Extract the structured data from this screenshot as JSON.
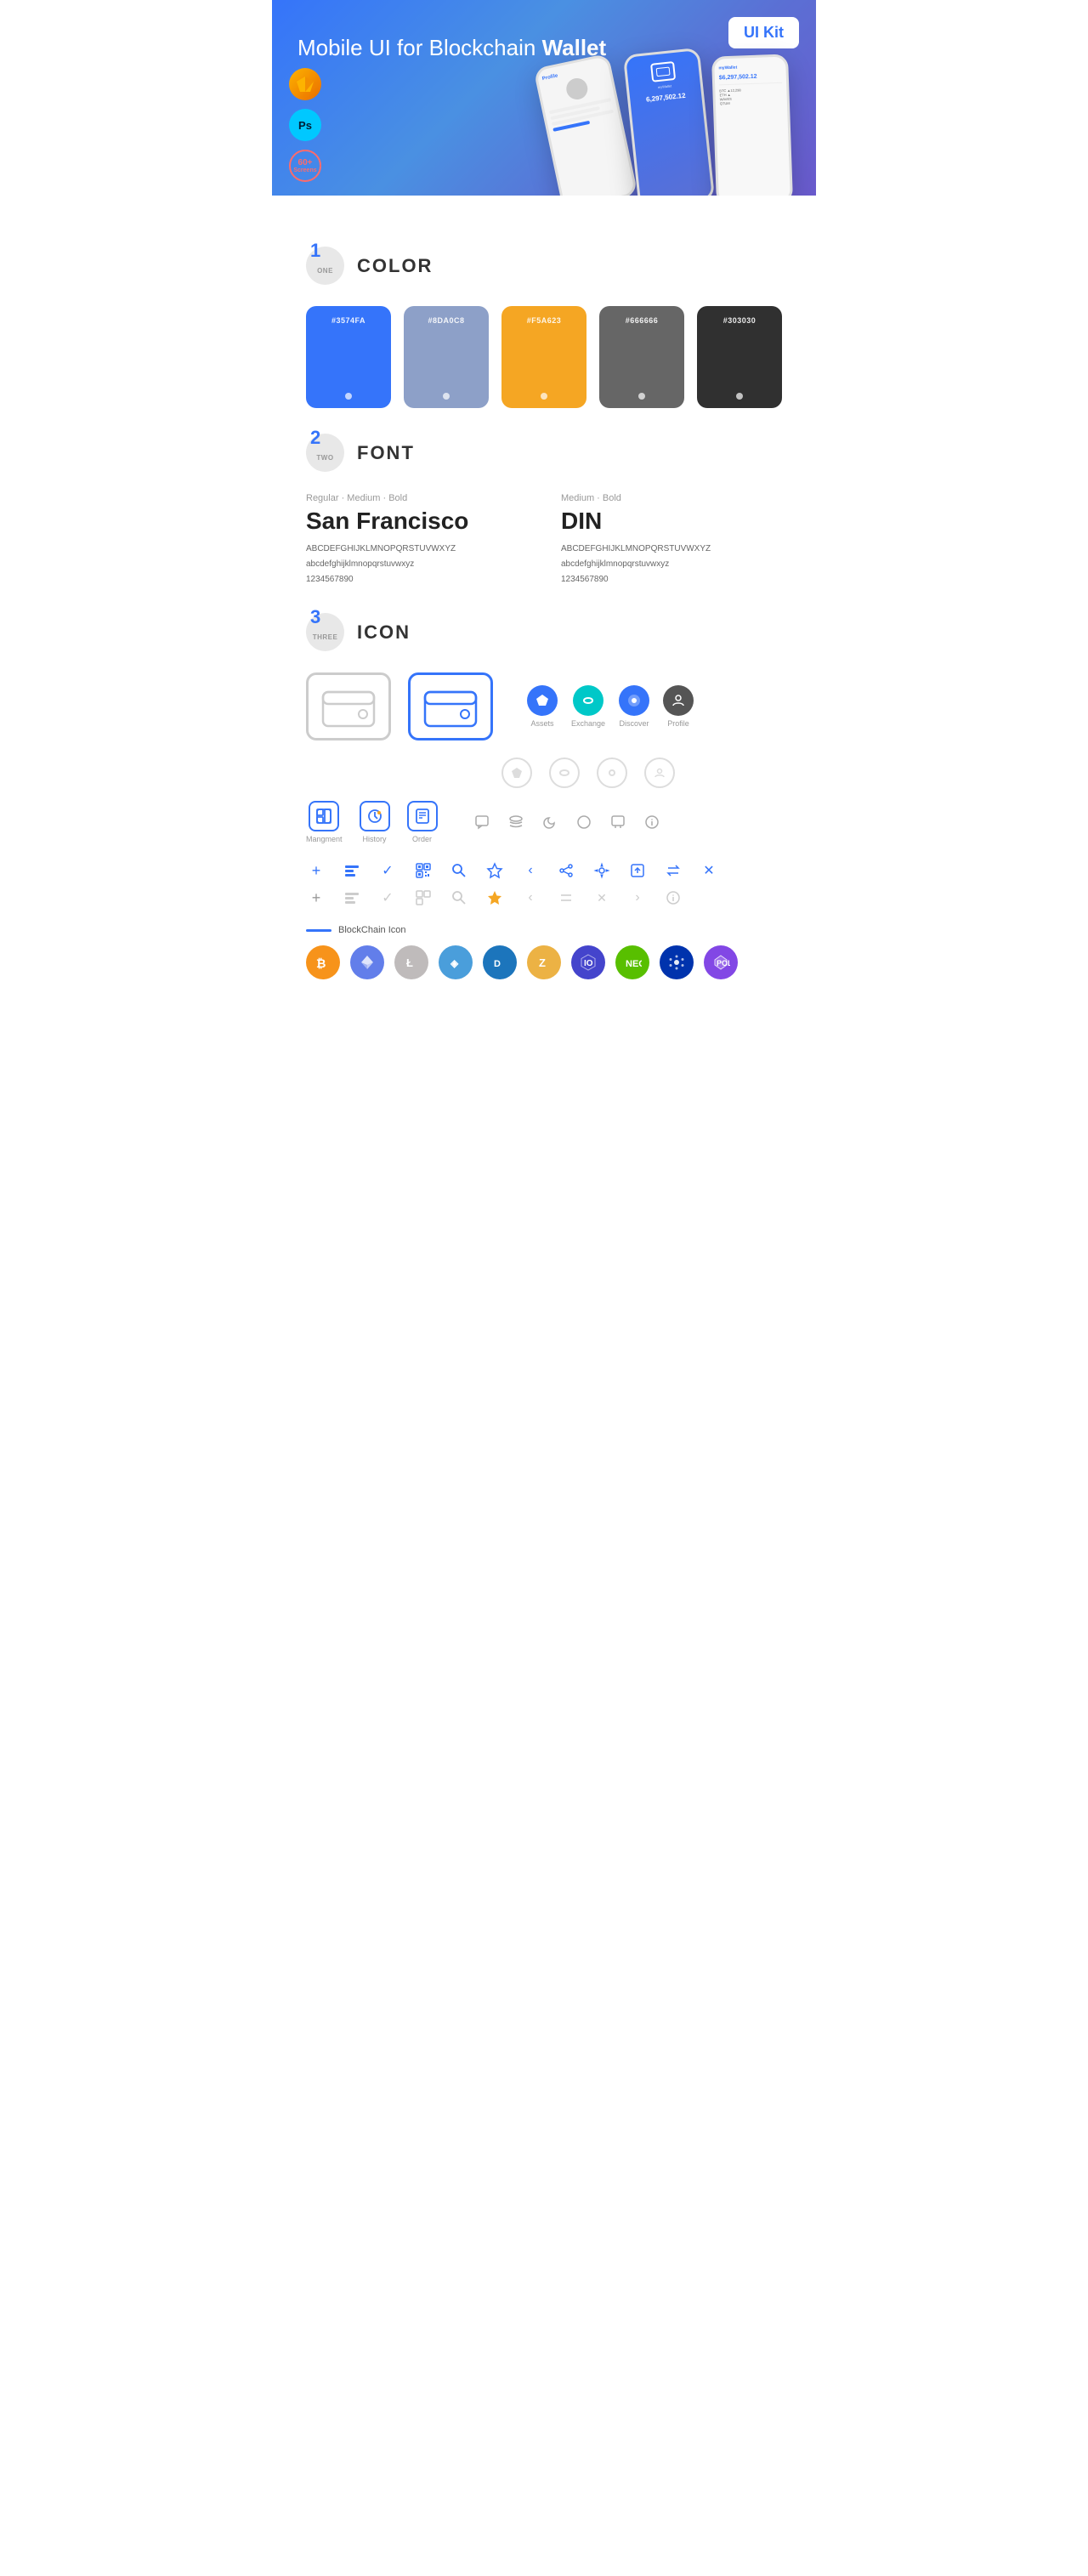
{
  "hero": {
    "title": "Mobile UI for Blockchain ",
    "title_bold": "Wallet",
    "badge": "UI Kit",
    "sketch_label": "Sk",
    "ps_label": "Ps",
    "screens_count": "60+",
    "screens_label": "Screens"
  },
  "sections": {
    "color": {
      "number": "1",
      "number_text": "ONE",
      "title": "COLOR",
      "swatches": [
        {
          "hex": "#3574FA",
          "label": "#3574FA"
        },
        {
          "hex": "#8DA0C8",
          "label": "#8DA0C8"
        },
        {
          "hex": "#F5A623",
          "label": "#F5A623"
        },
        {
          "hex": "#666666",
          "label": "#666666"
        },
        {
          "hex": "#303030",
          "label": "#303030"
        }
      ]
    },
    "font": {
      "number": "2",
      "number_text": "TWO",
      "title": "FONT",
      "fonts": [
        {
          "meta": "Regular · Medium · Bold",
          "name": "San Francisco",
          "uppercase": "ABCDEFGHIJKLMNOPQRSTUVWXYZ",
          "lowercase": "abcdefghijklmnopqrstuvwxyz",
          "numbers": "1234567890"
        },
        {
          "meta": "Medium · Bold",
          "name": "DIN",
          "uppercase": "ABCDEFGHIJKLMNOPQRSTUVWXYZ",
          "lowercase": "abcdefghijklmnopqrstuvwxyz",
          "numbers": "1234567890"
        }
      ]
    },
    "icon": {
      "number": "3",
      "number_text": "THREE",
      "title": "ICON",
      "nav_icons": [
        {
          "label": "Assets"
        },
        {
          "label": "Exchange"
        },
        {
          "label": "Discover"
        },
        {
          "label": "Profile"
        }
      ],
      "bottom_icons": [
        {
          "label": "Mangment"
        },
        {
          "label": "History"
        },
        {
          "label": "Order"
        }
      ],
      "blockchain_label": "BlockChain Icon",
      "crypto_icons": [
        {
          "name": "BTC",
          "color": "#F7931A"
        },
        {
          "name": "ETH",
          "color": "#627EEA"
        },
        {
          "name": "LTC",
          "color": "#BFBBBB"
        },
        {
          "name": "XRP",
          "color": "#4A9EDB"
        },
        {
          "name": "DASH",
          "color": "#1C75BC"
        },
        {
          "name": "ZEC",
          "color": "#ECB244"
        },
        {
          "name": "IOTA",
          "color": "#242424"
        },
        {
          "name": "NEO",
          "color": "#58BF00"
        },
        {
          "name": "ADA",
          "color": "#0033AD"
        },
        {
          "name": "MATIC",
          "color": "#8247E5"
        }
      ]
    }
  }
}
